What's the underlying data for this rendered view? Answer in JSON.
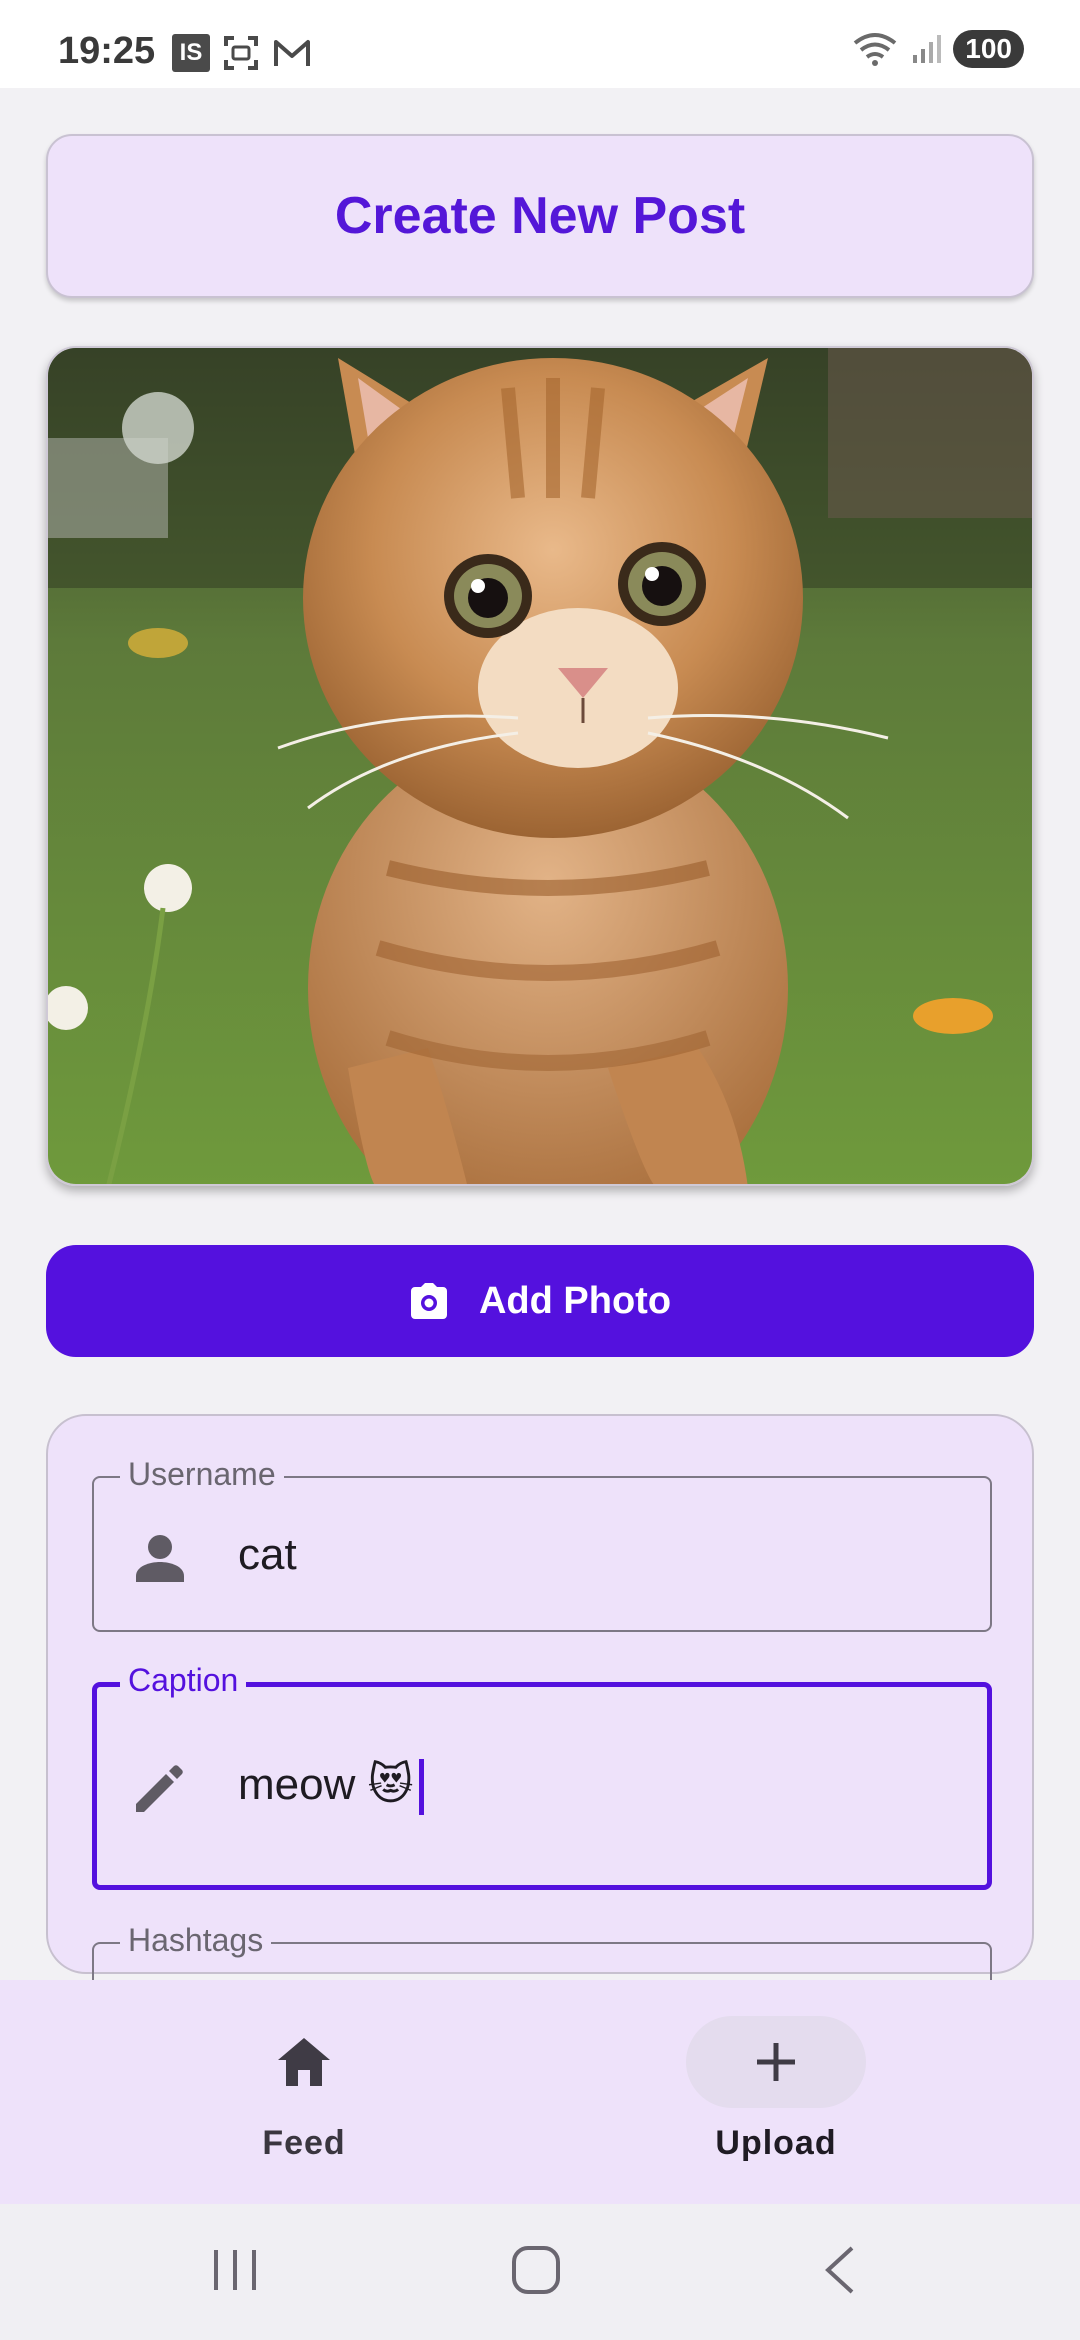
{
  "status_bar": {
    "time": "19:25",
    "left_badge": "IS",
    "battery": "100",
    "icons": [
      "is-badge-icon",
      "screenshot-icon",
      "gmail-icon",
      "wifi-icon",
      "signal-icon"
    ]
  },
  "header": {
    "title": "Create New Post"
  },
  "photo": {
    "description_icon": "cat-photo"
  },
  "add_photo": {
    "label": "Add Photo",
    "icon": "camera-icon"
  },
  "form": {
    "username": {
      "label": "Username",
      "value": "cat",
      "icon": "person-icon"
    },
    "caption": {
      "label": "Caption",
      "value": "meow 😻",
      "icon": "pencil-icon"
    },
    "hashtags": {
      "label": "Hashtags",
      "value": "",
      "icon": ""
    }
  },
  "bottom_nav": {
    "items": [
      {
        "label": "Feed",
        "icon": "home-icon",
        "active": false
      },
      {
        "label": "Upload",
        "icon": "plus-icon",
        "active": true
      }
    ]
  },
  "colors": {
    "accent": "#5411de",
    "card_bg": "#eee2fa",
    "page_bg": "#f2f1f4"
  }
}
